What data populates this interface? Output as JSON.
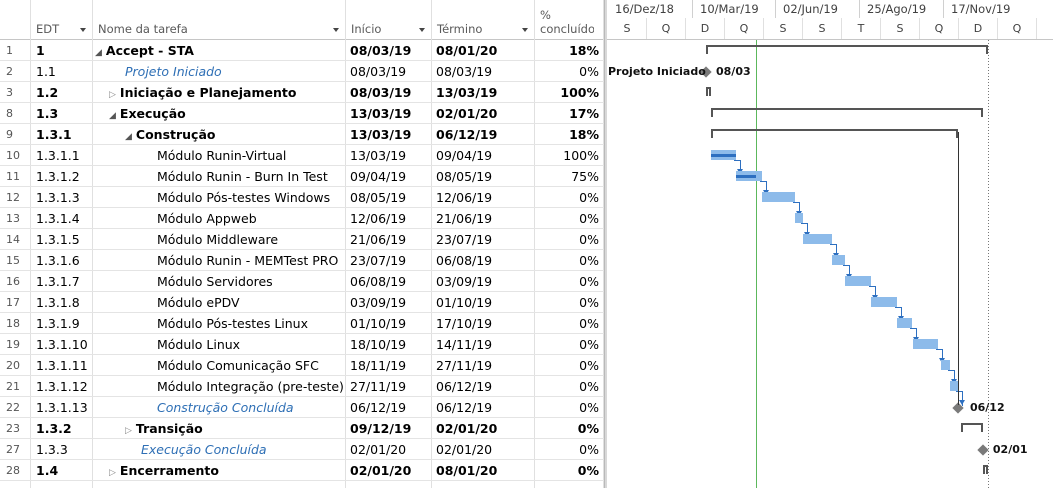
{
  "grid": {
    "headers": {
      "edt": "EDT",
      "name": "Nome da tarefa",
      "start": "Início",
      "end": "Término",
      "pct_top": "%",
      "pct_bottom": "concluído"
    },
    "rows": [
      {
        "n": "1",
        "edt": "1",
        "name": "Accept - STA",
        "start": "08/03/19",
        "end": "08/01/20",
        "pct": "18%",
        "level": 0,
        "type": "summary",
        "bold": true,
        "expander": "open"
      },
      {
        "n": "2",
        "edt": "1.1",
        "name": "Projeto Iniciado",
        "start": "08/03/19",
        "end": "08/03/19",
        "pct": "0%",
        "level": 1,
        "type": "milestone",
        "bold": false,
        "expander": ""
      },
      {
        "n": "3",
        "edt": "1.2",
        "name": "Iniciação e Planejamento",
        "start": "08/03/19",
        "end": "13/03/19",
        "pct": "100%",
        "level": 1,
        "type": "summary",
        "bold": true,
        "expander": "closed"
      },
      {
        "n": "8",
        "edt": "1.3",
        "name": "Execução",
        "start": "13/03/19",
        "end": "02/01/20",
        "pct": "17%",
        "level": 1,
        "type": "summary",
        "bold": true,
        "expander": "open"
      },
      {
        "n": "9",
        "edt": "1.3.1",
        "name": "Construção",
        "start": "13/03/19",
        "end": "06/12/19",
        "pct": "18%",
        "level": 2,
        "type": "summary",
        "bold": true,
        "expander": "open"
      },
      {
        "n": "10",
        "edt": "1.3.1.1",
        "name": "Módulo Runin-Virtual",
        "start": "13/03/19",
        "end": "09/04/19",
        "pct": "100%",
        "level": 3,
        "type": "task",
        "bold": false,
        "expander": ""
      },
      {
        "n": "11",
        "edt": "1.3.1.2",
        "name": "Módulo Runin - Burn In Test",
        "start": "09/04/19",
        "end": "08/05/19",
        "pct": "75%",
        "level": 3,
        "type": "task",
        "bold": false,
        "expander": ""
      },
      {
        "n": "12",
        "edt": "1.3.1.3",
        "name": "Módulo Pós-testes Windows",
        "start": "08/05/19",
        "end": "12/06/19",
        "pct": "0%",
        "level": 3,
        "type": "task",
        "bold": false,
        "expander": ""
      },
      {
        "n": "13",
        "edt": "1.3.1.4",
        "name": "Módulo Appweb",
        "start": "12/06/19",
        "end": "21/06/19",
        "pct": "0%",
        "level": 3,
        "type": "task",
        "bold": false,
        "expander": ""
      },
      {
        "n": "14",
        "edt": "1.3.1.5",
        "name": "Módulo Middleware",
        "start": "21/06/19",
        "end": "23/07/19",
        "pct": "0%",
        "level": 3,
        "type": "task",
        "bold": false,
        "expander": ""
      },
      {
        "n": "15",
        "edt": "1.3.1.6",
        "name": "Módulo Runin - MEMTest PRO",
        "start": "23/07/19",
        "end": "06/08/19",
        "pct": "0%",
        "level": 3,
        "type": "task",
        "bold": false,
        "expander": ""
      },
      {
        "n": "16",
        "edt": "1.3.1.7",
        "name": "Módulo Servidores",
        "start": "06/08/19",
        "end": "03/09/19",
        "pct": "0%",
        "level": 3,
        "type": "task",
        "bold": false,
        "expander": ""
      },
      {
        "n": "17",
        "edt": "1.3.1.8",
        "name": "Módulo ePDV",
        "start": "03/09/19",
        "end": "01/10/19",
        "pct": "0%",
        "level": 3,
        "type": "task",
        "bold": false,
        "expander": ""
      },
      {
        "n": "18",
        "edt": "1.3.1.9",
        "name": "Módulo Pós-testes Linux",
        "start": "01/10/19",
        "end": "17/10/19",
        "pct": "0%",
        "level": 3,
        "type": "task",
        "bold": false,
        "expander": ""
      },
      {
        "n": "19",
        "edt": "1.3.1.10",
        "name": "Módulo Linux",
        "start": "18/10/19",
        "end": "14/11/19",
        "pct": "0%",
        "level": 3,
        "type": "task",
        "bold": false,
        "expander": ""
      },
      {
        "n": "20",
        "edt": "1.3.1.11",
        "name": "Módulo Comunicação SFC",
        "start": "18/11/19",
        "end": "27/11/19",
        "pct": "0%",
        "level": 3,
        "type": "task",
        "bold": false,
        "expander": ""
      },
      {
        "n": "21",
        "edt": "1.3.1.12",
        "name": "Módulo Integração (pre-teste)",
        "start": "27/11/19",
        "end": "06/12/19",
        "pct": "0%",
        "level": 3,
        "type": "task",
        "bold": false,
        "expander": ""
      },
      {
        "n": "22",
        "edt": "1.3.1.13",
        "name": "Construção Concluída",
        "start": "06/12/19",
        "end": "06/12/19",
        "pct": "0%",
        "level": 3,
        "type": "milestone",
        "bold": false,
        "expander": ""
      },
      {
        "n": "23",
        "edt": "1.3.2",
        "name": "Transição",
        "start": "09/12/19",
        "end": "02/01/20",
        "pct": "0%",
        "level": 2,
        "type": "summary",
        "bold": true,
        "expander": "closed"
      },
      {
        "n": "27",
        "edt": "1.3.3",
        "name": "Execução Concluída",
        "start": "02/01/20",
        "end": "02/01/20",
        "pct": "0%",
        "level": 2,
        "type": "milestone",
        "bold": false,
        "expander": ""
      },
      {
        "n": "28",
        "edt": "1.4",
        "name": "Encerramento",
        "start": "02/01/20",
        "end": "08/01/20",
        "pct": "0%",
        "level": 1,
        "type": "summary",
        "bold": true,
        "expander": "closed"
      }
    ]
  },
  "timeline": {
    "top": [
      "16/Dez/18",
      "10/Mar/19",
      "02/Jun/19",
      "25/Ago/19",
      "17/Nov/19"
    ],
    "bottom": [
      "S",
      "Q",
      "D",
      "Q",
      "S",
      "S",
      "T",
      "S",
      "Q",
      "D",
      "Q"
    ]
  },
  "gantt": {
    "milestone_labels": {
      "projeto_name": "Projeto Iniciado",
      "projeto_date": "08/03",
      "construcao_date": "06/12",
      "execucao_date": "02/01"
    },
    "colors": {
      "task": "#8dbbea",
      "progress": "#2d6fc0",
      "summary": "#555555",
      "today": "#5cb85c"
    }
  }
}
